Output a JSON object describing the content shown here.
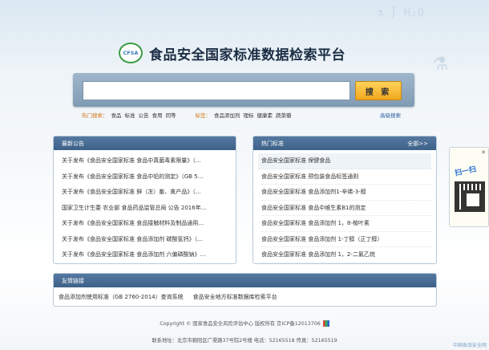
{
  "header": {
    "logo_text": "CFSA",
    "title": "食品安全国家标准数据检索平台"
  },
  "search": {
    "value": "",
    "placeholder": "",
    "button_label": "搜 索",
    "hot_label": "热门搜索：",
    "hot_terms": [
      "食品",
      "标准",
      "公告",
      "食用",
      "同等"
    ],
    "tag_label": "标签：",
    "tags": [
      "食品添加剂",
      "理标",
      "健康素",
      "蔬菜瓣"
    ],
    "advanced_label": "高级搜索"
  },
  "news": {
    "title": "最新公告",
    "items": [
      "关于发布《食品安全国家标准 食品中真菌毒素限量》（…",
      "关于发布《食品安全国家标准 食品中铅的测定》（GB 5…",
      "关于发布《食品安全国家标准 鲜（冻）畜、禽产品》（…",
      "国家卫生计生委 农业部 食品药品监管总局 公告 2016年…",
      "关于发布《食品安全国家标准 食品接触材料及制品通用…",
      "关于发布《食品安全国家标准 食品添加剂 碳酸氢钙》（…",
      "关于发布《食品安全国家标准 食品添加剂 六偏磷酸钠》…"
    ]
  },
  "hot_standards": {
    "title": "热门标准",
    "more_label": "全部>>",
    "items": [
      "食品安全国家标准 保健食品",
      "食品安全国家标准 预包装食品标签通则",
      "食品安全国家标准 食品添加剂1-辛烯-3-醇",
      "食品安全国家标准 食品中维生素B1的测定",
      "食品安全国家标准 食品添加剂 1，8-桉叶素",
      "食品安全国家标准 食品添加剂 1-丁醇（正丁醇）",
      "食品安全国家标准 食品添加剂 1，2-二氯乙烷"
    ]
  },
  "links": {
    "title": "友情链接",
    "items": [
      "食品添加剂使用标准（GB 2760-2014）查询系统",
      "食品安全地方标准数据库检索平台"
    ]
  },
  "footer": {
    "line1": "Copyright © 国家食品安全风险评估中心 版权所有 京ICP备12013706",
    "line2": "联系地址：北京市朝阳区广渠路37号院2号楼  电话：52165518  传真：52165519"
  },
  "qr_float": {
    "close_label": "✕",
    "label": "扫一扫"
  },
  "watermark": "中国食品安全网"
}
